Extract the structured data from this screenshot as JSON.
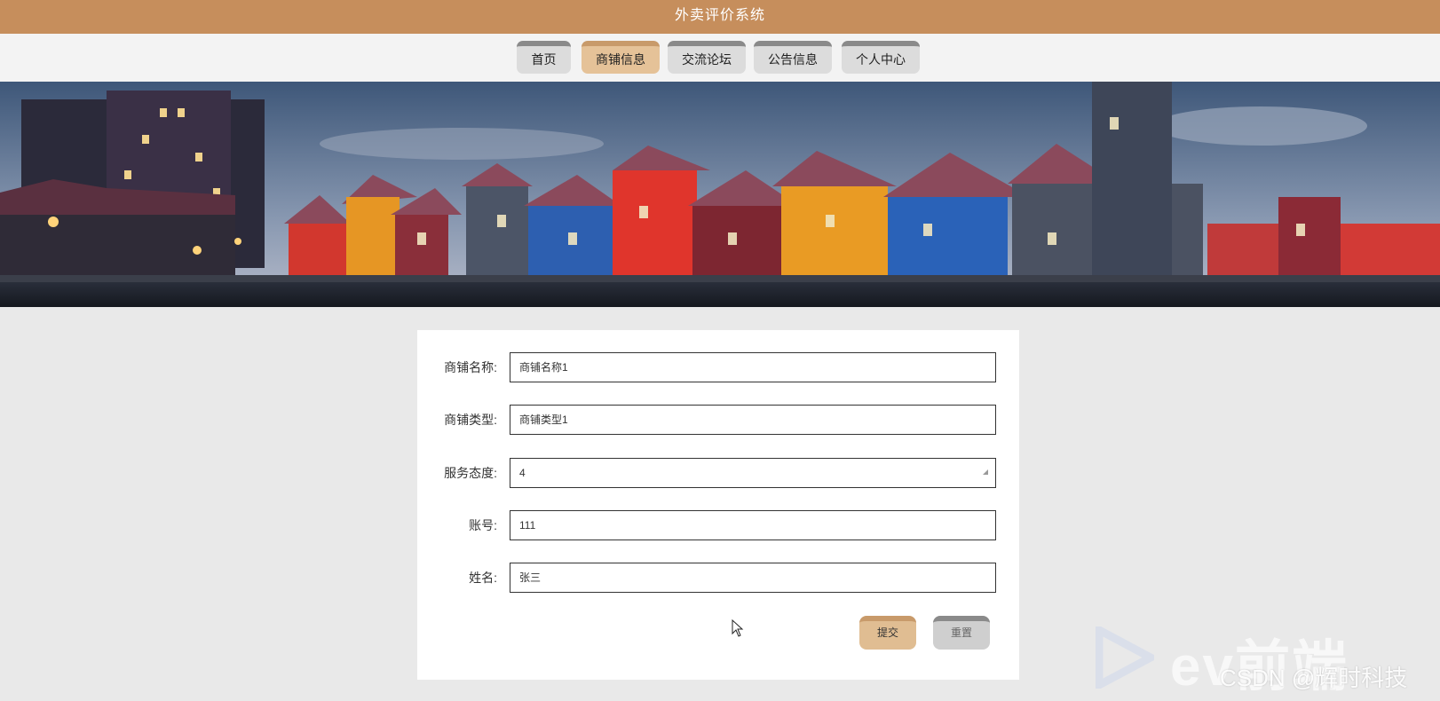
{
  "app": {
    "title": "外卖评价系统"
  },
  "nav": {
    "items": [
      {
        "label": "首页"
      },
      {
        "label": "商铺信息"
      },
      {
        "label": "交流论坛"
      },
      {
        "label": "公告信息"
      },
      {
        "label": "个人中心"
      }
    ],
    "active_index": 1
  },
  "form": {
    "fields": [
      {
        "label": "商铺名称:",
        "value": "商铺名称1"
      },
      {
        "label": "商铺类型:",
        "value": "商铺类型1"
      },
      {
        "label": "服务态度:",
        "value": "4"
      },
      {
        "label": "账号:",
        "value": "111"
      },
      {
        "label": "姓名:",
        "value": "张三"
      }
    ],
    "submit_label": "提交",
    "reset_label": "重置"
  },
  "watermark": {
    "ev_text": "ev前端",
    "csdn_text": "CSDN @辉时科技"
  },
  "colors": {
    "header": "#c68e5c",
    "nav_active": "#e5c298",
    "nav_inactive": "#dcdcdc",
    "submit_button": "#e0bd92",
    "reset_button": "#cfcfcf"
  },
  "icons": {
    "dropdown": "dropdown-arrow-icon",
    "cursor": "mouse-pointer-icon"
  }
}
